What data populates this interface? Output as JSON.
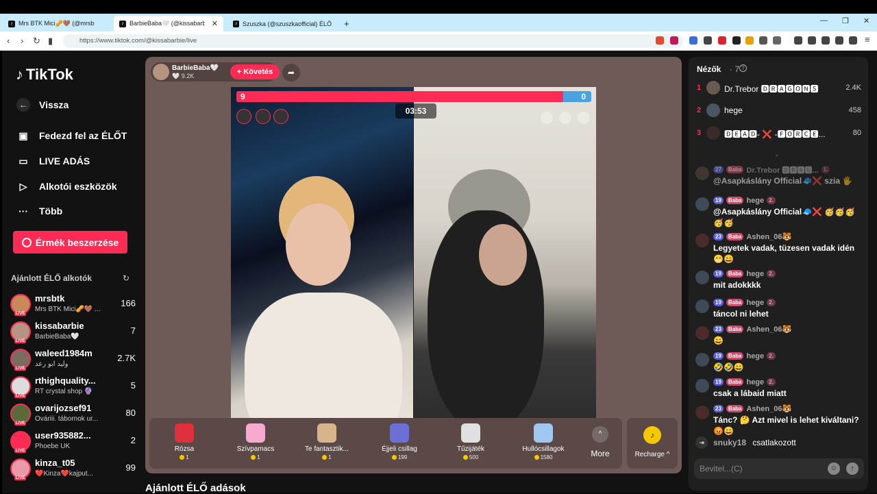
{
  "browser": {
    "tabs": [
      {
        "label": "Mrs BTK Mici🥜🤎 (@mrsb",
        "active": false
      },
      {
        "label": "BarbieBaba🤍 (@kissabarbie",
        "active": true
      },
      {
        "label": "Szuszka (@szuszkaofficial) ÉLŐ adás",
        "active": false
      }
    ],
    "new_tab": "+",
    "url": "https://www.tiktok.com/@kissabarbie/live"
  },
  "sidebar": {
    "logo": "TikTok",
    "back": "Vissza",
    "nav": [
      {
        "label": "Fedezd fel az ÉLŐT",
        "icon": "live-calendar-icon"
      },
      {
        "label": "LIVE ADÁS",
        "icon": "camera-icon"
      },
      {
        "label": "Alkotói eszközök",
        "icon": "creator-tools-icon"
      },
      {
        "label": "Több",
        "icon": "more-dots-icon"
      }
    ],
    "coins_button": "Érmék beszerzése",
    "recommended_header": "Ajánlott ÉLŐ alkotók",
    "creators": [
      {
        "name": "mrsbtk",
        "sub": "Mrs BTK Mici🥜🤎 ...",
        "count": "166"
      },
      {
        "name": "kissabarbie",
        "sub": "BarbieBaba🤍",
        "count": "7"
      },
      {
        "name": "waleed1984m",
        "sub": "وليد ابو رعد",
        "count": "2.7K"
      },
      {
        "name": "rthighquality...",
        "sub": "RT crystal shop 🔮",
        "count": "5"
      },
      {
        "name": "ovarijozsef91",
        "sub": "Ováriii. tábornok ur...",
        "count": "80"
      },
      {
        "name": "user935882...",
        "sub": "Phoebe UK",
        "count": "2"
      },
      {
        "name": "kinza_t05",
        "sub": "❤️Kinza❤️kajput...",
        "count": "99"
      }
    ],
    "live_badge": "LIVE"
  },
  "live": {
    "host_name": "BarbieBaba🤍",
    "host_likes": "🤍 9.2K",
    "follow": "+ Követés",
    "battle": {
      "left_score": "9",
      "right_score": "0",
      "left_share": 0.92
    },
    "timer": "03:53",
    "gifts": [
      {
        "name": "Rózsa",
        "price": "1",
        "color": "#e0303c"
      },
      {
        "name": "Szívpamacs",
        "price": "1",
        "color": "#f7a9d0"
      },
      {
        "name": "Te fantasztik...",
        "price": "1",
        "color": "#d8b48a"
      },
      {
        "name": "Éjjeli csillag",
        "price": "199",
        "color": "#6b6fd6"
      },
      {
        "name": "Tűzijáték",
        "price": "500",
        "color": "#e0e0e0"
      },
      {
        "name": "Hullócsillagok",
        "price": "1580",
        "color": "#9fc7f0"
      }
    ],
    "more": "More",
    "recharge": "Recharge ^",
    "recommended_live": "Ajánlott ÉLŐ adások"
  },
  "viewers": {
    "title": "Nézők",
    "count": "· 7",
    "list": [
      {
        "rank": "1",
        "name": "Dr.Trebor 🅳🆁🅰🅶🅾🅽🆂",
        "score": "2.4K"
      },
      {
        "rank": "2",
        "name": "hege",
        "score": "458"
      },
      {
        "rank": "3",
        "name": "🅳🅴🅰🅳- ❌ -🅵🅾🆁🅲🅴...",
        "score": "80"
      }
    ]
  },
  "chat": {
    "messages": [
      {
        "lvl": "27",
        "fan": "Baba",
        "user": "Dr.Trebor 🅳🆁🅰🅶...",
        "rank": "1.",
        "text": "@Asapkáslány Official🧢❌ szia 🖐️",
        "faded": true
      },
      {
        "lvl": "19",
        "fan": "Baba",
        "user": "hege",
        "rank": "2.",
        "text": "@Asapkáslány Official🧢❌ 🥳🥳🥳🥳🥳"
      },
      {
        "lvl": "23",
        "fan": "Baba",
        "user": "Ashen_06🐯",
        "rank": "",
        "text": "Legyetek vadak, tüzesen vadak idén 😁😄"
      },
      {
        "lvl": "19",
        "fan": "Baba",
        "user": "hege",
        "rank": "2.",
        "text": "mit adokkkk"
      },
      {
        "lvl": "19",
        "fan": "Baba",
        "user": "hege",
        "rank": "2.",
        "text": "táncol ni lehet"
      },
      {
        "lvl": "23",
        "fan": "Baba",
        "user": "Ashen_06🐯",
        "rank": "",
        "text": "😄"
      },
      {
        "lvl": "19",
        "fan": "Baba",
        "user": "hege",
        "rank": "2.",
        "text": "🤣🤣😄"
      },
      {
        "lvl": "19",
        "fan": "Baba",
        "user": "hege",
        "rank": "2.",
        "text": "csak a lábaid miatt"
      },
      {
        "lvl": "23",
        "fan": "Baba",
        "user": "Ashen_06🐯",
        "rank": "",
        "text": "Tánc? 🤔 Azt mivel is lehet kiváltani? 😡😄"
      }
    ],
    "joined_user": "snuky18",
    "joined_text": "csatlakozott",
    "input_placeholder": "Bevitel...(C)"
  }
}
